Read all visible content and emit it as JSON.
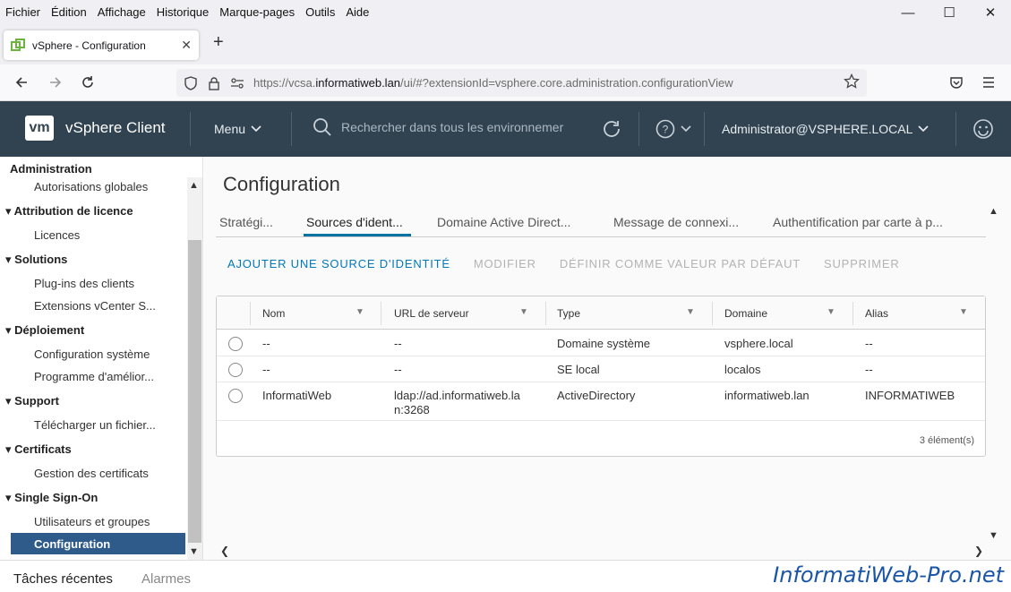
{
  "menubar": {
    "items": [
      "Fichier",
      "Édition",
      "Affichage",
      "Historique",
      "Marque-pages",
      "Outils",
      "Aide"
    ]
  },
  "browser": {
    "tab_title": "vSphere - Configuration",
    "url_prefix": "https://vcsa.",
    "url_domain": "informatiweb.lan",
    "url_suffix": "/ui/#?extensionId=vsphere.core.administration.configurationView"
  },
  "header": {
    "logo": "vm",
    "title": "vSphere Client",
    "menu": "Menu",
    "search_placeholder": "Rechercher dans tous les environnemer",
    "user": "Administrator@VSPHERE.LOCAL"
  },
  "sidebar": {
    "title": "Administration",
    "items": [
      {
        "label": "Autorisations globales",
        "type": "child"
      },
      {
        "label": "Attribution de licence",
        "type": "head"
      },
      {
        "label": "Licences",
        "type": "child"
      },
      {
        "label": "Solutions",
        "type": "head"
      },
      {
        "label": "Plug-ins des clients",
        "type": "child"
      },
      {
        "label": "Extensions vCenter S...",
        "type": "child"
      },
      {
        "label": "Déploiement",
        "type": "head"
      },
      {
        "label": "Configuration système",
        "type": "child"
      },
      {
        "label": "Programme d'amélior...",
        "type": "child"
      },
      {
        "label": "Support",
        "type": "head"
      },
      {
        "label": "Télécharger un fichier...",
        "type": "child"
      },
      {
        "label": "Certificats",
        "type": "head"
      },
      {
        "label": "Gestion des certificats",
        "type": "child"
      },
      {
        "label": "Single Sign-On",
        "type": "head"
      },
      {
        "label": "Utilisateurs et groupes",
        "type": "child"
      },
      {
        "label": "Configuration",
        "type": "active"
      }
    ]
  },
  "main": {
    "title": "Configuration",
    "tabs": [
      "Stratégi...",
      "Sources d'ident...",
      "Domaine Active Direct...",
      "Message de connexi...",
      "Authentification par carte à p..."
    ],
    "actions": [
      "AJOUTER UNE SOURCE D'IDENTITÉ",
      "MODIFIER",
      "DÉFINIR COMME VALEUR PAR DÉFAUT",
      "SUPPRIMER"
    ],
    "columns": [
      "Nom",
      "URL de serveur",
      "Type",
      "Domaine",
      "Alias"
    ],
    "rows": [
      {
        "nom": "--",
        "url": "--",
        "type": "Domaine système",
        "domaine": "vsphere.local",
        "alias": "--"
      },
      {
        "nom": "--",
        "url": "--",
        "type": "SE local",
        "domaine": "localos",
        "alias": "--"
      },
      {
        "nom": "InformatiWeb",
        "url": "ldap://ad.informatiweb.la",
        "url2": "n:3268",
        "type": "ActiveDirectory",
        "domaine": "informatiweb.lan",
        "alias": "INFORMATIWEB"
      }
    ],
    "count": "3 élément(s)"
  },
  "bottom": {
    "recent_tasks": "Tâches récentes",
    "alarms": "Alarmes"
  },
  "watermark": "InformatiWeb-Pro.net",
  "colors": {
    "header": "#314351",
    "accent": "#0079b8",
    "active": "#2f5b8a"
  }
}
